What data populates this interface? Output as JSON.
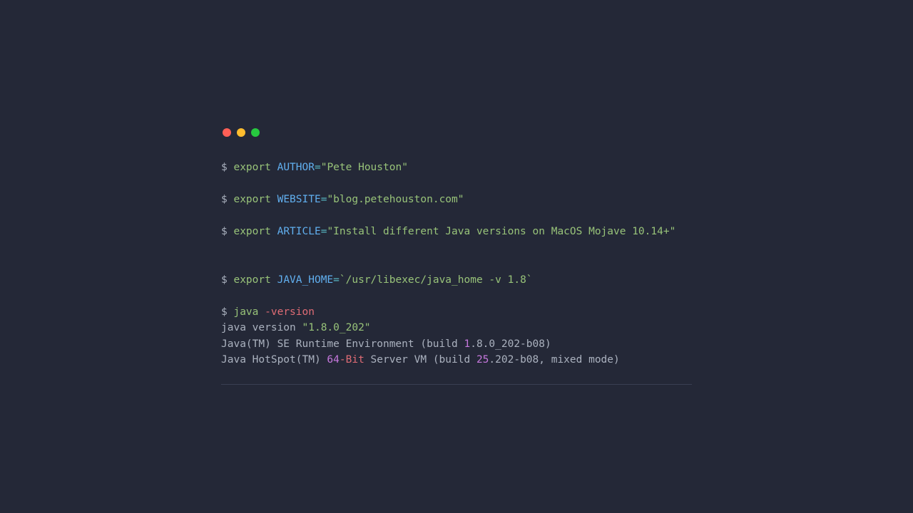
{
  "terminal": {
    "lines": [
      {
        "blank": false,
        "tokens": [
          {
            "t": "$ ",
            "c": "prompt"
          },
          {
            "t": "export",
            "c": "keyword"
          },
          {
            "t": " ",
            "c": "plain"
          },
          {
            "t": "AUTHOR",
            "c": "var"
          },
          {
            "t": "=",
            "c": "op"
          },
          {
            "t": "\"Pete Houston\"",
            "c": "str"
          }
        ]
      },
      {
        "blank": true
      },
      {
        "blank": false,
        "tokens": [
          {
            "t": "$ ",
            "c": "prompt"
          },
          {
            "t": "export",
            "c": "keyword"
          },
          {
            "t": " ",
            "c": "plain"
          },
          {
            "t": "WEBSITE",
            "c": "var"
          },
          {
            "t": "=",
            "c": "op"
          },
          {
            "t": "\"blog.petehouston.com\"",
            "c": "str"
          }
        ]
      },
      {
        "blank": true
      },
      {
        "blank": false,
        "tokens": [
          {
            "t": "$ ",
            "c": "prompt"
          },
          {
            "t": "export",
            "c": "keyword"
          },
          {
            "t": " ",
            "c": "plain"
          },
          {
            "t": "ARTICLE",
            "c": "var"
          },
          {
            "t": "=",
            "c": "op"
          },
          {
            "t": "\"Install different Java versions on MacOS Mojave 10.14+\"",
            "c": "str"
          }
        ]
      },
      {
        "blank": true
      },
      {
        "blank": true
      },
      {
        "blank": false,
        "tokens": [
          {
            "t": "$ ",
            "c": "prompt"
          },
          {
            "t": "export",
            "c": "keyword"
          },
          {
            "t": " ",
            "c": "plain"
          },
          {
            "t": "JAVA_HOME",
            "c": "var"
          },
          {
            "t": "=",
            "c": "op"
          },
          {
            "t": "`/usr/libexec/java_home -v 1.8`",
            "c": "str"
          }
        ]
      },
      {
        "blank": true
      },
      {
        "blank": false,
        "tokens": [
          {
            "t": "$ ",
            "c": "prompt"
          },
          {
            "t": "java",
            "c": "keyword"
          },
          {
            "t": " ",
            "c": "plain"
          },
          {
            "t": "-version",
            "c": "arg"
          }
        ]
      },
      {
        "blank": false,
        "tokens": [
          {
            "t": "java version ",
            "c": "plain"
          },
          {
            "t": "\"1.8.0_202\"",
            "c": "str"
          }
        ]
      },
      {
        "blank": false,
        "tokens": [
          {
            "t": "Java(TM) SE Runtime Environment (build ",
            "c": "plain"
          },
          {
            "t": "1",
            "c": "num"
          },
          {
            "t": ".",
            "c": "plain"
          },
          {
            "t": "8",
            "c": "plain"
          },
          {
            "t": ".0_202-b08)",
            "c": "plain"
          }
        ]
      },
      {
        "blank": false,
        "tokens": [
          {
            "t": "Java HotSpot(TM) ",
            "c": "plain"
          },
          {
            "t": "64",
            "c": "num"
          },
          {
            "t": "-Bit",
            "c": "arg"
          },
          {
            "t": " Server VM (build ",
            "c": "plain"
          },
          {
            "t": "25",
            "c": "num"
          },
          {
            "t": ".",
            "c": "plain"
          },
          {
            "t": "202",
            "c": "plain"
          },
          {
            "t": "-b08, mixed mode)",
            "c": "plain"
          }
        ]
      }
    ]
  }
}
